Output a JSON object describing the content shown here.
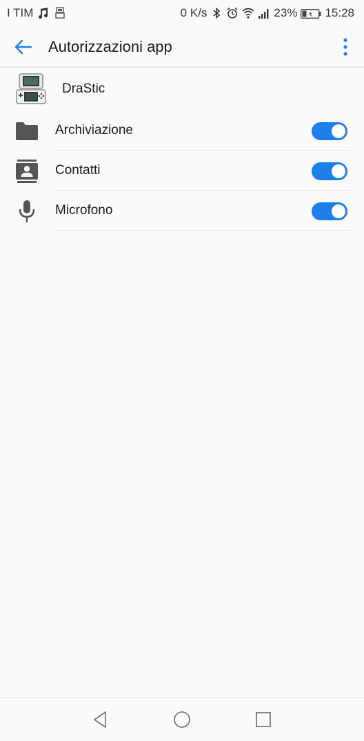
{
  "status_bar": {
    "carrier": "I TIM",
    "left_icons": [
      "music-note-icon",
      "drastic-notification-icon"
    ],
    "net_speed": "0 K/s",
    "right_icons": [
      "bluetooth-icon",
      "alarm-icon",
      "wifi-icon",
      "signal-icon"
    ],
    "battery_percent": "23%",
    "time": "15:28"
  },
  "app_bar": {
    "back_icon": "arrow-left-icon",
    "title": "Autorizzazioni app",
    "overflow_icon": "more-vert-icon"
  },
  "app": {
    "icon": "nintendo-ds-icon",
    "name": "DraStic"
  },
  "permissions": [
    {
      "icon": "folder-icon",
      "label": "Archiviazione",
      "enabled": true
    },
    {
      "icon": "contacts-icon",
      "label": "Contatti",
      "enabled": true
    },
    {
      "icon": "microphone-icon",
      "label": "Microfono",
      "enabled": true
    }
  ],
  "nav_bar": {
    "buttons": [
      "back-triangle-icon",
      "home-circle-icon",
      "recents-square-icon"
    ]
  },
  "colors": {
    "accent": "#1f7fe8",
    "background": "#fafafa",
    "icon_gray": "#555555"
  }
}
